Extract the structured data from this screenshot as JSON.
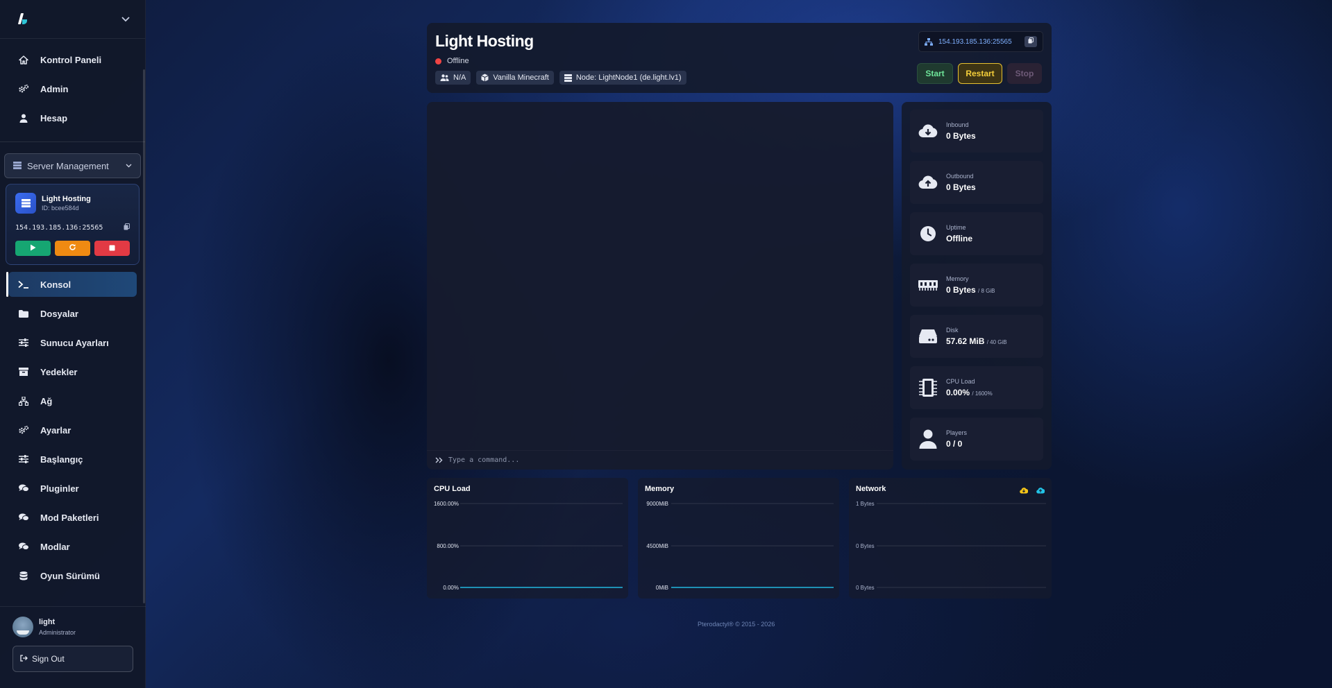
{
  "sidebar": {
    "nav_top": [
      {
        "label": "Kontrol Paneli",
        "icon": "home-icon"
      },
      {
        "label": "Admin",
        "icon": "gears-icon"
      },
      {
        "label": "Hesap",
        "icon": "user-icon"
      }
    ],
    "server_management_label": "Server Management",
    "server_card": {
      "name": "Light Hosting",
      "id": "ID: bcee584d",
      "ip": "154.193.185.136:25565"
    },
    "nav_server": [
      {
        "label": "Konsol",
        "icon": "terminal-icon",
        "active": true
      },
      {
        "label": "Dosyalar",
        "icon": "folder-icon"
      },
      {
        "label": "Sunucu Ayarları",
        "icon": "sliders-icon"
      },
      {
        "label": "Yedekler",
        "icon": "archive-icon"
      },
      {
        "label": "Ağ",
        "icon": "network-icon"
      },
      {
        "label": "Ayarlar",
        "icon": "gears-icon"
      },
      {
        "label": "Başlangıç",
        "icon": "sliders-icon"
      },
      {
        "label": "Pluginler",
        "icon": "comments-icon"
      },
      {
        "label": "Mod Paketleri",
        "icon": "comments-icon"
      },
      {
        "label": "Modlar",
        "icon": "comments-icon"
      },
      {
        "label": "Oyun Sürümü",
        "icon": "database-icon"
      }
    ],
    "user": {
      "name": "light",
      "role": "Administrator"
    },
    "sign_out_label": "Sign Out"
  },
  "header": {
    "title": "Light Hosting",
    "status": "Offline",
    "tags": [
      {
        "label": "N/A",
        "icon": "users-icon"
      },
      {
        "label": "Vanilla Minecraft",
        "icon": "cube-icon"
      },
      {
        "label": "Node: LightNode1 (de.light.lv1)",
        "icon": "server-icon"
      }
    ],
    "ip": "154.193.185.136:25565",
    "start_label": "Start",
    "restart_label": "Restart",
    "stop_label": "Stop"
  },
  "console": {
    "placeholder": "Type a command..."
  },
  "stats": [
    {
      "label": "Inbound",
      "value": "0 Bytes",
      "suffix": "",
      "icon": "cloud-download-icon"
    },
    {
      "label": "Outbound",
      "value": "0 Bytes",
      "suffix": "",
      "icon": "cloud-upload-icon"
    },
    {
      "label": "Uptime",
      "value": "Offline",
      "suffix": "",
      "icon": "clock-icon"
    },
    {
      "label": "Memory",
      "value": "0 Bytes",
      "suffix": "/ 8 GiB",
      "icon": "memory-icon"
    },
    {
      "label": "Disk",
      "value": "57.62 MiB",
      "suffix": "/ 40 GiB",
      "icon": "hdd-icon"
    },
    {
      "label": "CPU Load",
      "value": "0.00%",
      "suffix": "/ 1600%",
      "icon": "cpu-icon"
    },
    {
      "label": "Players",
      "value": "0 / 0",
      "suffix": "",
      "icon": "user-icon"
    }
  ],
  "graphs": [
    {
      "title": "CPU Load",
      "ticks": [
        "1600.00%",
        "800.00%",
        "0.00%"
      ]
    },
    {
      "title": "Memory",
      "ticks": [
        "9000MiB",
        "4500MiB",
        "0MiB"
      ]
    },
    {
      "title": "Network",
      "ticks": [
        "1 Bytes",
        "0 Bytes",
        "0 Bytes"
      ]
    }
  ],
  "chart_data": [
    {
      "type": "line",
      "title": "CPU Load",
      "ylim": [
        0,
        1600
      ],
      "y_ticks": [
        "1600.00%",
        "800.00%",
        "0.00%"
      ],
      "series": [
        {
          "values": [
            0,
            0,
            0,
            0,
            0,
            0,
            0,
            0,
            0,
            0
          ]
        }
      ],
      "color": "#22b8e0"
    },
    {
      "type": "line",
      "title": "Memory",
      "ylim": [
        0,
        9000
      ],
      "y_ticks": [
        "9000MiB",
        "4500MiB",
        "0MiB"
      ],
      "series": [
        {
          "values": [
            0,
            0,
            0,
            0,
            0,
            0,
            0,
            0,
            0,
            0
          ]
        }
      ],
      "color": "#22b8e0"
    },
    {
      "type": "line",
      "title": "Network",
      "ylim": [
        0,
        1
      ],
      "y_ticks": [
        "1 Bytes",
        "0 Bytes",
        "0 Bytes"
      ],
      "series": []
    }
  ],
  "colors": {
    "accent": "#22b8e0",
    "status_offline": "#ef4444",
    "start": "#6ee59a",
    "restart": "#f5cf3a",
    "network_inbound": "#f5c518",
    "network_outbound": "#22c3e6"
  },
  "footer": "Pterodactyl® © 2015 - 2026"
}
